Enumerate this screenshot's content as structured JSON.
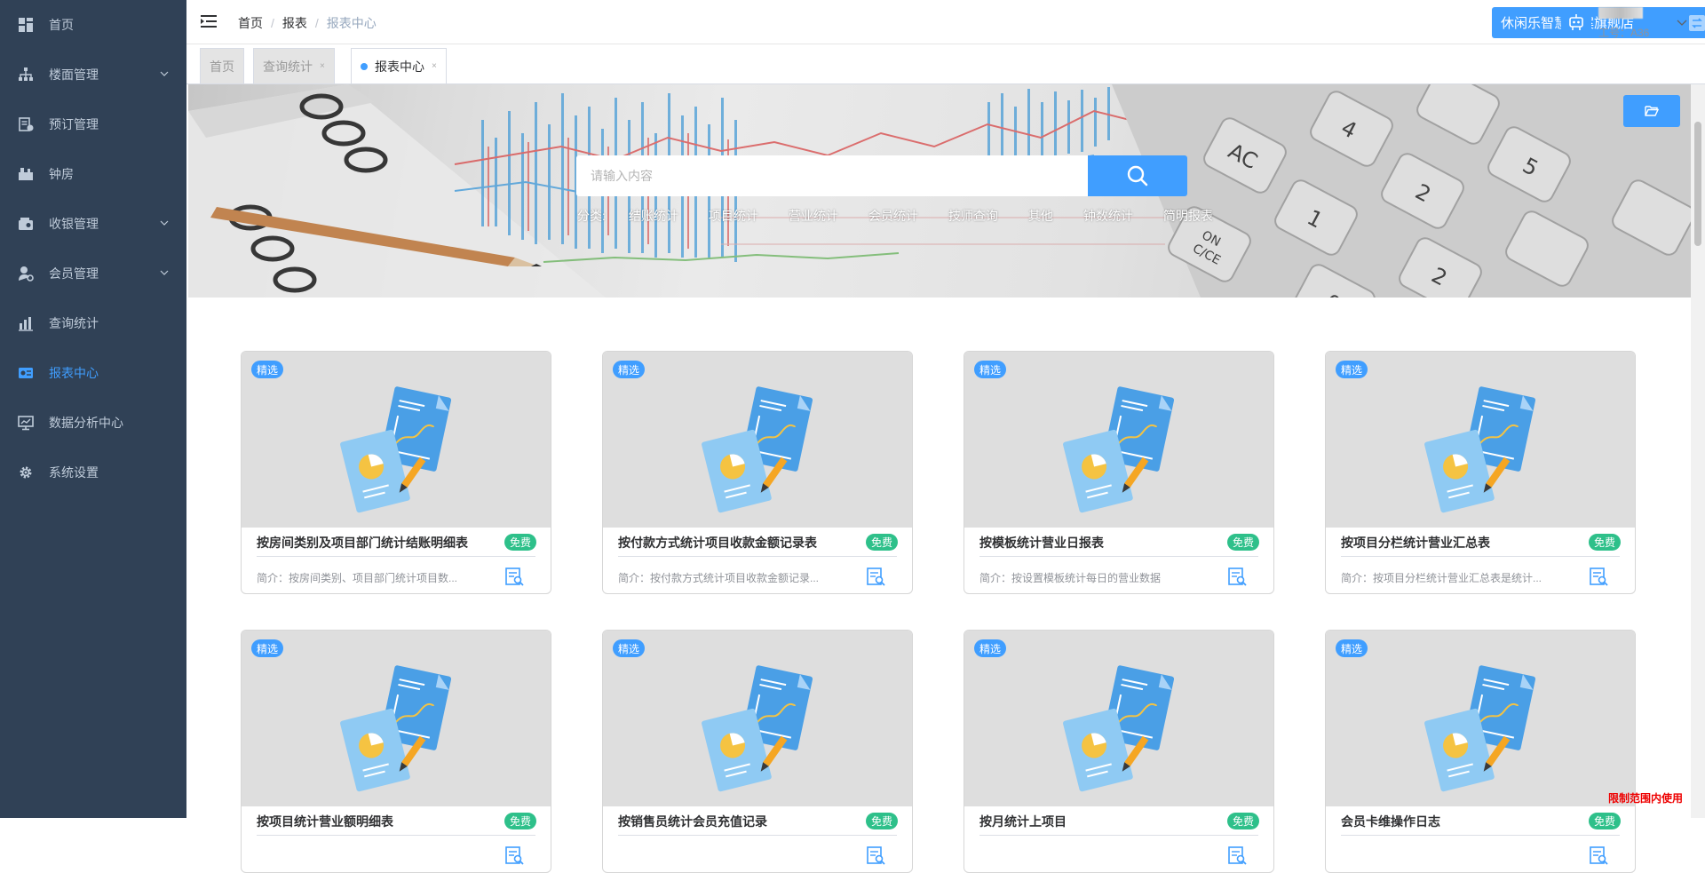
{
  "sidebar": {
    "items": [
      {
        "label": "首页",
        "icon": "dashboard-icon",
        "active": false,
        "expandable": false
      },
      {
        "label": "楼面管理",
        "icon": "sitemap-icon",
        "active": false,
        "expandable": true
      },
      {
        "label": "预订管理",
        "icon": "booking-icon",
        "active": false,
        "expandable": false
      },
      {
        "label": "钟房",
        "icon": "clock-room-icon",
        "active": false,
        "expandable": false
      },
      {
        "label": "收银管理",
        "icon": "cashier-icon",
        "active": false,
        "expandable": true
      },
      {
        "label": "会员管理",
        "icon": "member-icon",
        "active": false,
        "expandable": true
      },
      {
        "label": "查询统计",
        "icon": "stats-icon",
        "active": false,
        "expandable": false
      },
      {
        "label": "报表中心",
        "icon": "report-icon",
        "active": true,
        "expandable": false
      },
      {
        "label": "数据分析中心",
        "icon": "analysis-icon",
        "active": false,
        "expandable": false
      },
      {
        "label": "系统设置",
        "icon": "settings-gear-icon",
        "active": false,
        "expandable": false
      }
    ]
  },
  "navbar": {
    "breadcrumb": [
      "首页",
      "报表",
      "报表中心"
    ],
    "store_name": "休闲乐智慧方案旗舰店",
    "user_no": "工号：A36"
  },
  "tags": [
    {
      "label": "首页",
      "closable": false,
      "active": false
    },
    {
      "label": "查询统计",
      "closable": true,
      "active": false
    },
    {
      "label": "报表中心",
      "closable": true,
      "active": true
    }
  ],
  "banner": {
    "search_placeholder": "请输入内容",
    "category_label": "分类:",
    "categories": [
      "结账统计",
      "项目统计",
      "营业统计",
      "会员统计",
      "技师查询",
      "其他",
      "钟数统计",
      "简明报表"
    ]
  },
  "cards": [
    {
      "badge": "精选",
      "title": "按房间类别及项目部门统计结账明细表",
      "free": "免费",
      "desc": "简介：按房间类别、项目部门统计项目数..."
    },
    {
      "badge": "精选",
      "title": "按付款方式统计项目收款金额记录表",
      "free": "免费",
      "desc": "简介：按付款方式统计项目收款金额记录..."
    },
    {
      "badge": "精选",
      "title": "按模板统计营业日报表",
      "free": "免费",
      "desc": "简介：按设置模板统计每日的营业数据"
    },
    {
      "badge": "精选",
      "title": "按项目分栏统计营业汇总表",
      "free": "免费",
      "desc": "简介：按项目分栏统计营业汇总表是统计..."
    },
    {
      "badge": "精选",
      "title": "按项目统计营业额明细表",
      "free": "免费",
      "desc": ""
    },
    {
      "badge": "精选",
      "title": "按销售员统计会员充值记录",
      "free": "免费",
      "desc": ""
    },
    {
      "badge": "精选",
      "title": "按月统计上项目",
      "free": "免费",
      "desc": ""
    },
    {
      "badge": "精选",
      "title": "会员卡维操作日志",
      "free": "免费",
      "desc": ""
    }
  ],
  "footer": {
    "limit_text": "限制范围内使用"
  },
  "colors": {
    "sidebar_bg": "#304156",
    "accent": "#409eff",
    "free_badge": "#2ec08a"
  }
}
